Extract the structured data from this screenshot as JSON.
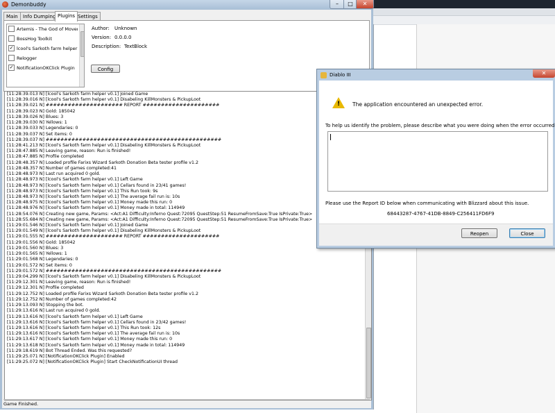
{
  "window": {
    "title": "Demonbuddy",
    "minimize": "–",
    "maximize": "□",
    "close": "✕"
  },
  "tabs": [
    {
      "label": "Main"
    },
    {
      "label": "Info Dumping"
    },
    {
      "label": "Plugins"
    },
    {
      "label": "Settings"
    }
  ],
  "plugins": {
    "items": [
      {
        "label": "Artemis - The God of Moveme",
        "checked": false
      },
      {
        "label": "BossHog Toolkit",
        "checked": false
      },
      {
        "label": "lcool's Sarkoth farm helper v0.",
        "checked": true
      },
      {
        "label": "Relogger",
        "checked": false
      },
      {
        "label": "NotificationOKClick Plugin",
        "checked": true
      }
    ],
    "author_label": "Author:",
    "author_value": "Unknown",
    "version_label": "Version:",
    "version_value": "0.0.0.0",
    "description_label": "Description:",
    "description_value": "TextBlock",
    "config_button": "Config"
  },
  "log_lines": [
    "[11:28:39.013 N] [lcool's Sarkoth farm helper v0.1] Joined Game",
    "[11:28:39.016 N] [lcool's Sarkoth farm helper v0.1] Disabeling KillMonsters & PickupLoot",
    "[11:28:39.021 N] ##################### REPORT #####################",
    "[11:28:39.023 N] Gold: 185042",
    "[11:28:39.026 N] Blues: 3",
    "[11:28:39.030 N] Yellows: 1",
    "[11:28:39.033 N] Legendaries: 0",
    "[11:28:39.037 N] Set items: 0",
    "[11:28:39.037 N] ################################################",
    "[11:28:41.213 N] [lcool's Sarkoth farm helper v0.1] Disabeling KillMonsters & PickupLoot",
    "[11:28:47.885 N] Leaving game, reason: Run is finished!",
    "[11:28:47.885 N] Profile completed",
    "[11:28:48.357 N] Loaded profile Farixs Wizard Sarkoth Donation Beta tester profile v1.2",
    "[11:28:48.357 N] Number of games completed:41",
    "[11:28:48.973 N] Last run acquired 0 gold.",
    "[11:28:48.973 N] [lcool's Sarkoth farm helper v0.1] Left Game",
    "[11:28:48.973 N] [lcool's Sarkoth farm helper v0.1] Cellars found in 23/41 games!",
    "[11:28:48.973 N] [lcool's Sarkoth farm helper v0.1] This Run took: 9s",
    "[11:28:48.973 N] [lcool's Sarkoth farm helper v0.1] The average fail run is: 10s",
    "[11:28:48.975 N] [lcool's Sarkoth farm helper v0.1] Money made this run: 0",
    "[11:28:48.976 N] [lcool's Sarkoth farm helper v0.1] Money made in total: 114949",
    "[11:28:54.076 N] Creating new game, Params: <Act:A1 Difficulty:Inferno Quest:72095 QuestStep:51 ResumeFromSave:True IsPrivate:True>",
    "[11:28:55.684 N] Creating new game, Params: <Act:A1 Difficulty:Inferno Quest:72095 QuestStep:51 ResumeFromSave:True IsPrivate:True>",
    "[11:29:01.546 N] [lcool's Sarkoth farm helper v0.1] Joined Game",
    "[11:29:01.549 N] [lcool's Sarkoth farm helper v0.1] Disabeling KillMonsters & PickupLoot",
    "[11:29:01.555 N] ##################### REPORT #####################",
    "[11:29:01.556 N] Gold: 185042",
    "[11:29:01.560 N] Blues: 3",
    "[11:29:01.565 N] Yellows: 1",
    "[11:29:01.568 N] Legendaries: 0",
    "[11:29:01.572 N] Set items: 0",
    "[11:29:01.572 N] ################################################",
    "[11:29:04.299 N] [lcool's Sarkoth farm helper v0.1] Disabeling KillMonsters & PickupLoot",
    "[11:29:12.301 N] Leaving game, reason: Run is finished!",
    "[11:29:12.301 N] Profile completed",
    "[11:29:12.752 N] Loaded profile Farixs Wizard Sarkoth Donation Beta tester profile v1.2",
    "[11:29:12.752 N] Number of games completed:42",
    "[11:29:13.093 N] Stopping the bot.",
    "[11:29:13.616 N] Last run acquired 0 gold.",
    "[11:29:13.616 N] [lcool's Sarkoth farm helper v0.1] Left Game",
    "[11:29:13.616 N] [lcool's Sarkoth farm helper v0.1] Cellars found in 23/42 games!",
    "[11:29:13.616 N] [lcool's Sarkoth farm helper v0.1] This Run took: 12s",
    "[11:29:13.616 N] [lcool's Sarkoth farm helper v0.1] The average fail run is: 10s",
    "[11:29:13.617 N] [lcool's Sarkoth farm helper v0.1] Money made this run: 0",
    "[11:29:13.618 N] [lcool's Sarkoth farm helper v0.1] Money made in total: 114949",
    "[11:29:18.619 N] Bot Thread Ended. Was this requested?",
    "[11:29:25.071 N] [NotificationOKClick Plugin] Enabled",
    "[11:29:25.072 N] [NotificationOKClick Plugin] Start CheckNotificationUI thread"
  ],
  "status_text": "Game Finished.",
  "dialog": {
    "title": "Diablo III",
    "close": "✕",
    "message": "The application encountered an unexpected error.",
    "prompt": "To help us identify the problem, please describe what you were doing when the error occurred.",
    "input_value": "",
    "report_text": "Please use the Report ID below when communicating with Blizzard about this issue.",
    "report_id": "68443287-4767-41DB-8849-C256411FD6F9",
    "reopen_button": "Reopen",
    "close_button": "Close"
  }
}
